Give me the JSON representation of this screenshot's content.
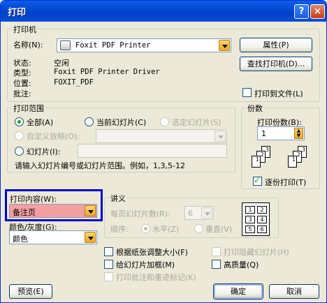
{
  "title": "打印",
  "title_buttons": {
    "help": "?",
    "close": "×"
  },
  "printer": {
    "group_title": "打印机",
    "name_label": "名称(N):",
    "name_value": "Foxit PDF Printer",
    "properties_btn": "属性(P)",
    "find_btn": "查找打印机(D)...",
    "status_label": "状态:",
    "status_value": "空闲",
    "type_label": "类型:",
    "type_value": "Foxit PDF Printer Driver",
    "location_label": "位置:",
    "location_value": "FOXIT_PDF",
    "comment_label": "批注:",
    "print_to_file": "打印到文件(L)"
  },
  "range": {
    "group_title": "打印范围",
    "all": "全部(A)",
    "current": "当前幻灯片(C)",
    "selection": "选定幻灯片(S)",
    "custom_show": "自定义放映(O):",
    "slides": "幻灯片(I):",
    "hint": "请输入幻灯片编号或幻灯片范围。例如，1,3,5-12"
  },
  "copies": {
    "group_title": "份数",
    "count_label": "打印份数(B):",
    "count_value": "1",
    "collate": "逐份打印(T)",
    "page_numbers": [
      "1",
      "2",
      "3",
      "1",
      "2",
      "3"
    ]
  },
  "print_what": {
    "label": "打印内容(W):",
    "value": "备注页"
  },
  "color": {
    "label": "颜色/灰度(G):",
    "value": "颜色"
  },
  "handouts": {
    "group_title": "讲义",
    "per_page_label": "每页幻灯片数(R):",
    "per_page_value": "6",
    "order_label": "顺序:",
    "horizontal": "水平(Z)",
    "vertical": "垂直(V)",
    "preview_numbers": [
      "1",
      "2",
      "3",
      "4",
      "5",
      "6"
    ]
  },
  "options": {
    "scale": "根据纸张调整大小(F)",
    "frame": "给幻灯片加框(M)",
    "comments": "打印批注和墨迹标记(K)",
    "hidden": "打印隐藏幻灯片(H)",
    "quality": "高质量(Q)"
  },
  "footer": {
    "preview": "预览(E)",
    "ok": "确定",
    "cancel": "取消"
  }
}
